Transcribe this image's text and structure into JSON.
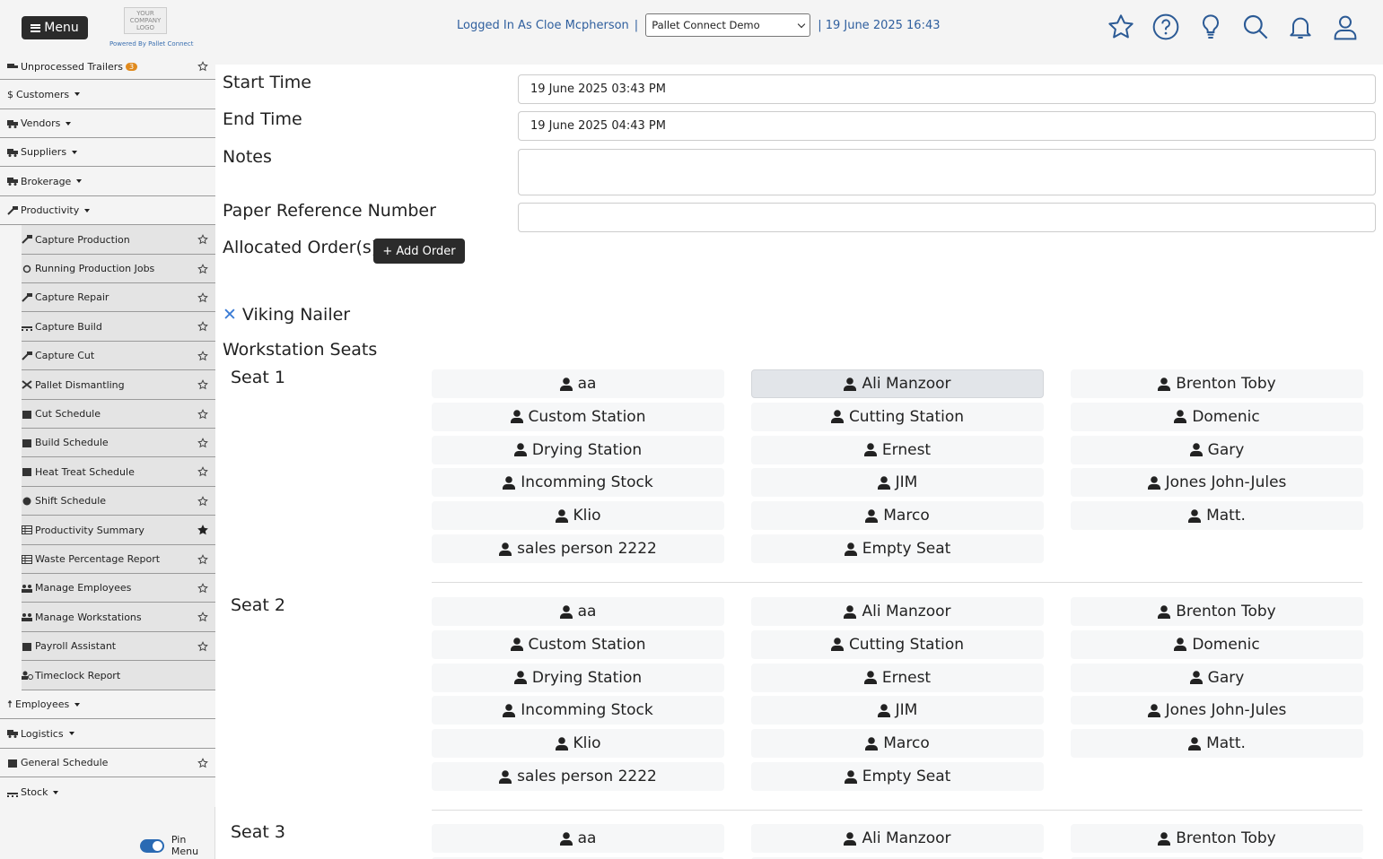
{
  "header": {
    "menu_label": "Menu",
    "logo_text": "YOUR COMPANY LOGO",
    "powered_by": "Powered By Pallet Connect",
    "logged_in_text": "Logged In As Cloe Mcpherson",
    "separator": "|",
    "company_selected": "Pallet Connect Demo",
    "datetime": "| 19 June 2025 16:43"
  },
  "sidebar": {
    "items": [
      {
        "label": "Unprocessed Trailers",
        "badge": "3",
        "type": "top",
        "star": true
      },
      {
        "label": "Customers",
        "type": "top",
        "dropdown": true
      },
      {
        "label": "Vendors",
        "type": "top",
        "dropdown": true
      },
      {
        "label": "Suppliers",
        "type": "top",
        "dropdown": true
      },
      {
        "label": "Brokerage",
        "type": "top",
        "dropdown": true
      },
      {
        "label": "Productivity",
        "type": "top",
        "dropdown": true
      },
      {
        "label": "Capture Production",
        "type": "sub"
      },
      {
        "label": "Running Production Jobs",
        "type": "sub"
      },
      {
        "label": "Capture Repair",
        "type": "sub"
      },
      {
        "label": "Capture Build",
        "type": "sub"
      },
      {
        "label": "Capture Cut",
        "type": "sub"
      },
      {
        "label": "Pallet Dismantling",
        "type": "sub"
      },
      {
        "label": "Cut Schedule",
        "type": "sub"
      },
      {
        "label": "Build Schedule",
        "type": "sub"
      },
      {
        "label": "Heat Treat Schedule",
        "type": "sub"
      },
      {
        "label": "Shift Schedule",
        "type": "sub"
      },
      {
        "label": "Productivity Summary",
        "type": "sub",
        "favorited": true
      },
      {
        "label": "Waste Percentage Report",
        "type": "sub"
      },
      {
        "label": "Manage Employees",
        "type": "sub"
      },
      {
        "label": "Manage Workstations",
        "type": "sub"
      },
      {
        "label": "Payroll Assistant",
        "type": "sub"
      },
      {
        "label": "Timeclock Report",
        "type": "sub"
      },
      {
        "label": "Employees",
        "type": "top",
        "dropdown": true
      },
      {
        "label": "Logistics",
        "type": "top",
        "dropdown": true
      },
      {
        "label": "General Schedule",
        "type": "top",
        "star": true
      },
      {
        "label": "Stock",
        "type": "top",
        "dropdown": true
      }
    ],
    "pin_menu_label": "Pin Menu"
  },
  "form": {
    "start_time_label": "Start Time",
    "start_time_value": "19 June 2025 03:43 PM",
    "end_time_label": "End Time",
    "end_time_value": "19 June 2025 04:43 PM",
    "notes_label": "Notes",
    "notes_value": "",
    "paper_ref_label": "Paper Reference Number",
    "paper_ref_value": "",
    "allocated_orders_label": "Allocated Order(s)",
    "add_order_label": "+ Add Order",
    "workstation_name": "Viking Nailer",
    "workstation_seats_label": "Workstation Seats"
  },
  "seats": [
    {
      "label": "Seat 1",
      "selected": "Ali Manzoor"
    },
    {
      "label": "Seat 2",
      "selected": ""
    },
    {
      "label": "Seat 3",
      "selected": ""
    }
  ],
  "people": [
    "aa",
    "Ali Manzoor",
    "Brenton Toby",
    "Custom Station",
    "Cutting Station",
    "Domenic",
    "Drying Station",
    "Ernest",
    "Gary",
    "Incomming Stock",
    "JIM",
    "Jones John-Jules",
    "Klio",
    "Marco",
    "Matt.",
    "sales person 2222",
    "Empty Seat"
  ],
  "colors": {
    "accent_blue": "#2f5f9e",
    "dark_button": "#2b2b2b",
    "badge_orange": "#e08a1e",
    "toggle_blue": "#2a6ab3"
  }
}
